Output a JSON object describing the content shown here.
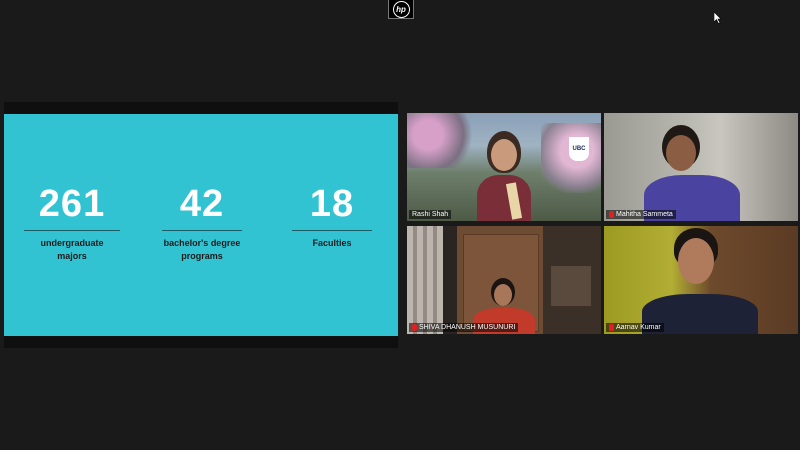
{
  "window": {
    "logo": "hp"
  },
  "slide": {
    "stats": [
      {
        "value": "261",
        "label_lines": [
          "undergraduate",
          "majors"
        ]
      },
      {
        "value": "42",
        "label_lines": [
          "bachelor's degree",
          "programs"
        ]
      },
      {
        "value": "18",
        "label_lines": [
          "Faculties"
        ]
      }
    ]
  },
  "participants": [
    {
      "name": "Rashi Shah",
      "muted": false,
      "active_speaker": true,
      "badge": "UBC"
    },
    {
      "name": "Mahitha Sammeta",
      "muted": true,
      "active_speaker": false
    },
    {
      "name": "SHIVA DHANUSH MUSUNURI",
      "muted": true,
      "active_speaker": false
    },
    {
      "name": "Aarnav Kumar",
      "muted": true,
      "active_speaker": false
    }
  ],
  "colors": {
    "slide_bg": "#31c3d2",
    "active_border": "#e0e033",
    "app_bg": "#1a1a1a"
  }
}
